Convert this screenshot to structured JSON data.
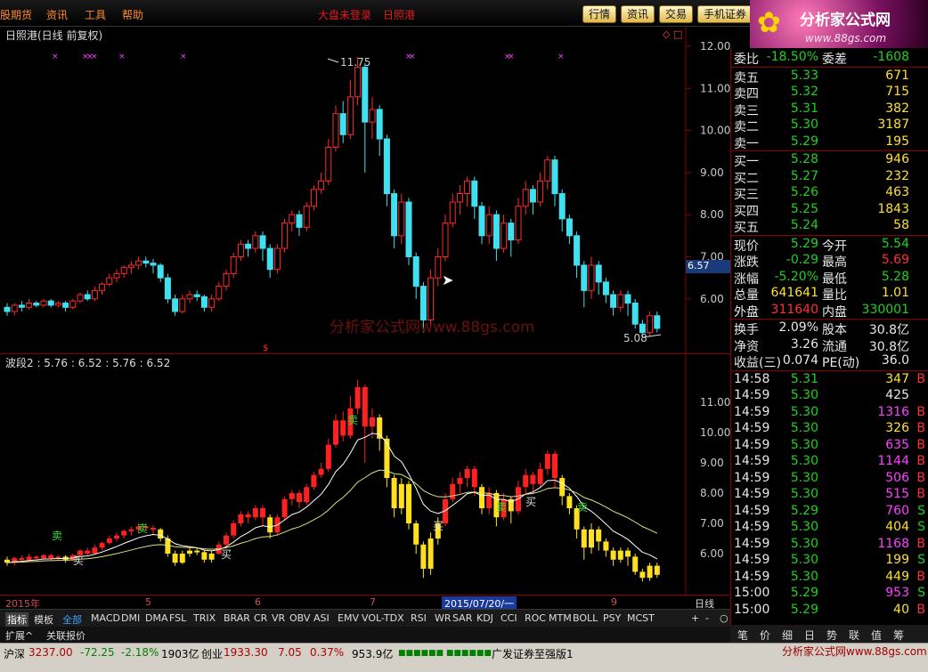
{
  "menu": {
    "items": [
      "股期货",
      "资讯",
      "工具",
      "帮助"
    ],
    "headline": "大盘未登录",
    "headline2": "日照港"
  },
  "quick_buttons": [
    "行情",
    "资讯",
    "交易",
    "手机证券"
  ],
  "logo": {
    "name": "分析家公式网",
    "url": "www.88gs.com"
  },
  "chart": {
    "title": "日照港(日线 前复权)",
    "indicator_title": "波段2 : 5.76 : 6.52      : 5.76 : 6.52",
    "watermark": "分析家公式网www.88gs.com",
    "price_axis": [
      "12.00",
      "11.00",
      "10.00",
      "9.00",
      "8.00",
      "7.00",
      "6.00"
    ],
    "ind_axis": [
      "11.00",
      "10.00",
      "9.00",
      "8.00",
      "7.00",
      "6.00"
    ],
    "high_label": "11.75",
    "low_label": "5.08",
    "current_tag": "6.57",
    "dates": [
      "2015年",
      "5",
      "6",
      "7",
      "2015/07/20/一",
      "9"
    ],
    "period": "日线",
    "candles": [
      [
        5.8,
        5.7,
        5.9,
        5.6
      ],
      [
        5.7,
        5.85,
        5.9,
        5.6
      ],
      [
        5.85,
        5.8,
        5.95,
        5.7
      ],
      [
        5.8,
        5.9,
        6.0,
        5.75
      ],
      [
        5.9,
        5.85,
        5.95,
        5.8
      ],
      [
        5.85,
        5.95,
        6.0,
        5.8
      ],
      [
        5.95,
        5.85,
        6.0,
        5.8
      ],
      [
        5.85,
        5.9,
        5.95,
        5.8
      ],
      [
        5.9,
        5.8,
        5.95,
        5.7
      ],
      [
        5.8,
        5.95,
        6.0,
        5.75
      ],
      [
        5.95,
        6.1,
        6.15,
        5.9
      ],
      [
        6.1,
        6.0,
        6.2,
        5.95
      ],
      [
        6.0,
        6.2,
        6.3,
        5.95
      ],
      [
        6.2,
        6.35,
        6.4,
        6.1
      ],
      [
        6.35,
        6.5,
        6.6,
        6.3
      ],
      [
        6.5,
        6.6,
        6.7,
        6.4
      ],
      [
        6.6,
        6.75,
        6.8,
        6.5
      ],
      [
        6.75,
        6.8,
        6.9,
        6.6
      ],
      [
        6.8,
        6.9,
        7.0,
        6.7
      ],
      [
        6.9,
        6.85,
        7.0,
        6.75
      ],
      [
        6.85,
        6.8,
        6.95,
        6.6
      ],
      [
        6.8,
        6.5,
        6.85,
        6.4
      ],
      [
        6.5,
        6.0,
        6.6,
        5.9
      ],
      [
        6.0,
        5.7,
        6.1,
        5.6
      ],
      [
        5.7,
        6.0,
        6.1,
        5.65
      ],
      [
        6.0,
        6.1,
        6.2,
        5.9
      ],
      [
        6.1,
        6.05,
        6.2,
        5.95
      ],
      [
        6.05,
        5.8,
        6.1,
        5.7
      ],
      [
        5.8,
        6.0,
        6.1,
        5.7
      ],
      [
        6.0,
        6.3,
        6.4,
        5.95
      ],
      [
        6.3,
        6.6,
        6.7,
        6.2
      ],
      [
        6.6,
        7.0,
        7.1,
        6.5
      ],
      [
        7.0,
        7.3,
        7.4,
        6.9
      ],
      [
        7.3,
        7.2,
        7.4,
        7.0
      ],
      [
        7.2,
        7.5,
        7.6,
        7.1
      ],
      [
        7.5,
        7.2,
        7.6,
        6.9
      ],
      [
        7.2,
        6.7,
        7.3,
        6.5
      ],
      [
        6.7,
        7.2,
        7.3,
        6.6
      ],
      [
        7.2,
        7.8,
        7.9,
        7.1
      ],
      [
        7.8,
        8.0,
        8.1,
        7.6
      ],
      [
        8.0,
        7.7,
        8.1,
        7.5
      ],
      [
        7.7,
        8.2,
        8.3,
        7.6
      ],
      [
        8.2,
        8.6,
        8.7,
        8.1
      ],
      [
        8.6,
        8.8,
        9.0,
        8.5
      ],
      [
        8.8,
        9.6,
        9.8,
        8.7
      ],
      [
        9.6,
        10.4,
        10.6,
        9.5
      ],
      [
        10.4,
        9.9,
        10.7,
        9.7
      ],
      [
        9.9,
        10.8,
        11.2,
        9.8
      ],
      [
        10.8,
        11.5,
        11.75,
        10.6
      ],
      [
        11.5,
        10.2,
        11.6,
        9.0
      ],
      [
        10.2,
        10.5,
        10.8,
        9.8
      ],
      [
        10.5,
        9.8,
        10.6,
        9.4
      ],
      [
        9.8,
        8.5,
        9.9,
        8.2
      ],
      [
        8.5,
        7.5,
        8.6,
        7.2
      ],
      [
        7.5,
        8.3,
        8.5,
        7.3
      ],
      [
        8.3,
        7.0,
        8.4,
        6.8
      ],
      [
        7.0,
        6.3,
        7.1,
        6.0
      ],
      [
        6.3,
        5.5,
        6.4,
        5.2
      ],
      [
        5.5,
        6.5,
        6.7,
        5.3
      ],
      [
        6.5,
        7.0,
        7.2,
        6.3
      ],
      [
        7.0,
        7.8,
        8.0,
        6.9
      ],
      [
        7.8,
        8.3,
        8.5,
        7.7
      ],
      [
        8.3,
        8.5,
        8.7,
        8.0
      ],
      [
        8.5,
        8.8,
        8.9,
        8.2
      ],
      [
        8.8,
        8.2,
        8.9,
        7.9
      ],
      [
        8.2,
        7.5,
        8.3,
        7.3
      ],
      [
        7.5,
        8.0,
        8.2,
        7.3
      ],
      [
        8.0,
        7.2,
        8.1,
        6.9
      ],
      [
        7.2,
        7.8,
        8.0,
        7.1
      ],
      [
        7.8,
        7.4,
        7.9,
        7.0
      ],
      [
        7.4,
        8.2,
        8.4,
        7.3
      ],
      [
        8.2,
        8.6,
        8.8,
        8.0
      ],
      [
        8.6,
        8.3,
        8.7,
        8.0
      ],
      [
        8.3,
        8.8,
        9.0,
        8.2
      ],
      [
        8.8,
        9.3,
        9.4,
        8.6
      ],
      [
        9.3,
        8.5,
        9.4,
        8.2
      ],
      [
        8.5,
        7.9,
        8.6,
        7.6
      ],
      [
        7.9,
        7.5,
        8.0,
        7.3
      ],
      [
        7.5,
        6.8,
        7.6,
        6.5
      ],
      [
        6.8,
        6.2,
        6.9,
        5.8
      ],
      [
        6.2,
        6.8,
        7.0,
        6.0
      ],
      [
        6.8,
        6.4,
        6.9,
        6.1
      ],
      [
        6.4,
        6.1,
        6.5,
        5.9
      ],
      [
        6.1,
        5.8,
        6.2,
        5.6
      ],
      [
        5.8,
        6.1,
        6.2,
        5.7
      ],
      [
        6.1,
        5.9,
        6.2,
        5.6
      ],
      [
        5.9,
        5.4,
        6.0,
        5.3
      ],
      [
        5.4,
        5.2,
        5.5,
        5.08
      ],
      [
        5.2,
        5.6,
        5.7,
        5.1
      ],
      [
        5.6,
        5.3,
        5.7,
        5.2
      ]
    ]
  },
  "quote": {
    "weibi": {
      "label": "委比",
      "value": "-18.50%",
      "label2": "委差",
      "value2": "-1608"
    },
    "sells": [
      {
        "label": "卖五",
        "price": "5.33",
        "vol": "671"
      },
      {
        "label": "卖四",
        "price": "5.32",
        "vol": "715"
      },
      {
        "label": "卖三",
        "price": "5.31",
        "vol": "382"
      },
      {
        "label": "卖二",
        "price": "5.30",
        "vol": "3187"
      },
      {
        "label": "卖一",
        "price": "5.29",
        "vol": "195"
      }
    ],
    "buys": [
      {
        "label": "买一",
        "price": "5.28",
        "vol": "946"
      },
      {
        "label": "买二",
        "price": "5.27",
        "vol": "232"
      },
      {
        "label": "买三",
        "price": "5.26",
        "vol": "463"
      },
      {
        "label": "买四",
        "price": "5.25",
        "vol": "1843"
      },
      {
        "label": "买五",
        "price": "5.24",
        "vol": "58"
      }
    ],
    "stats": [
      {
        "l1": "现价",
        "v1": "5.29",
        "l2": "今开",
        "v2": "5.54",
        "c1": "grn",
        "c2": "grn"
      },
      {
        "l1": "涨跌",
        "v1": "-0.29",
        "l2": "最高",
        "v2": "5.69",
        "c1": "grn",
        "c2": "red"
      },
      {
        "l1": "涨幅",
        "v1": "-5.20%",
        "l2": "最低",
        "v2": "5.28",
        "c1": "grn",
        "c2": "grn"
      },
      {
        "l1": "总量",
        "v1": "641641",
        "l2": "量比",
        "v2": "1.01",
        "c1": "yel",
        "c2": "yel"
      },
      {
        "l1": "外盘",
        "v1": "311640",
        "l2": "内盘",
        "v2": "330001",
        "c1": "red",
        "c2": "grn"
      }
    ],
    "stats2": [
      {
        "l1": "换手",
        "v1": "2.09%",
        "l2": "股本",
        "v2": "30.8亿"
      },
      {
        "l1": "净资",
        "v1": "3.26",
        "l2": "流通",
        "v2": "30.8亿"
      },
      {
        "l1": "收益(三)",
        "v1": "0.074",
        "l2": "PE(动)",
        "v2": "36.0"
      }
    ],
    "ticks": [
      {
        "t": "14:58",
        "p": "5.31",
        "v": "347",
        "s": "B",
        "vc": "yel",
        "sc": "red"
      },
      {
        "t": "14:59",
        "p": "5.30",
        "v": "425",
        "s": "",
        "vc": "wht",
        "sc": "red"
      },
      {
        "t": "14:59",
        "p": "5.30",
        "v": "1316",
        "s": "B",
        "vc": "mag",
        "sc": "red"
      },
      {
        "t": "14:59",
        "p": "5.30",
        "v": "326",
        "s": "B",
        "vc": "yel",
        "sc": "red"
      },
      {
        "t": "14:59",
        "p": "5.30",
        "v": "635",
        "s": "B",
        "vc": "mag",
        "sc": "red"
      },
      {
        "t": "14:59",
        "p": "5.30",
        "v": "1144",
        "s": "B",
        "vc": "mag",
        "sc": "red"
      },
      {
        "t": "14:59",
        "p": "5.30",
        "v": "506",
        "s": "B",
        "vc": "mag",
        "sc": "red"
      },
      {
        "t": "14:59",
        "p": "5.30",
        "v": "515",
        "s": "B",
        "vc": "mag",
        "sc": "red"
      },
      {
        "t": "14:59",
        "p": "5.29",
        "v": "760",
        "s": "S",
        "vc": "mag",
        "sc": "grn"
      },
      {
        "t": "14:59",
        "p": "5.30",
        "v": "404",
        "s": "S",
        "vc": "yel",
        "sc": "grn"
      },
      {
        "t": "14:59",
        "p": "5.30",
        "v": "1168",
        "s": "B",
        "vc": "mag",
        "sc": "red"
      },
      {
        "t": "14:59",
        "p": "5.30",
        "v": "199",
        "s": "S",
        "vc": "yel",
        "sc": "grn"
      },
      {
        "t": "14:59",
        "p": "5.30",
        "v": "449",
        "s": "B",
        "vc": "yel",
        "sc": "red"
      },
      {
        "t": "15:00",
        "p": "5.29",
        "v": "953",
        "s": "S",
        "vc": "mag",
        "sc": "grn"
      },
      {
        "t": "15:00",
        "p": "5.29",
        "v": "40",
        "s": "B",
        "vc": "yel",
        "sc": "red"
      }
    ]
  },
  "tabs": [
    "指标",
    "模板",
    "全部",
    "MACD",
    "DMI",
    "DMA",
    "FSL",
    "TRIX",
    "BRAR",
    "CR",
    "VR",
    "OBV",
    "ASI",
    "EMV",
    "VOL-TDX",
    "RSI",
    "WR",
    "SAR",
    "KDJ",
    "CCI",
    "ROC",
    "MTM",
    "BOLL",
    "PSY",
    "MCST"
  ],
  "tabs2": [
    "扩展^",
    "关联报价"
  ],
  "zoom_buttons": [
    "+",
    "-",
    "○"
  ],
  "right_tabs": [
    "笔",
    "价",
    "细",
    "日",
    "势",
    "联",
    "值",
    "筹"
  ],
  "status": {
    "sh_label": "沪深",
    "sh_val": "3237.00",
    "sh_chg": "-72.25",
    "sh_pct": "-2.18%",
    "sh_amt": "1903亿",
    "cy_label": "创业",
    "cy_val": "1933.30",
    "cy_chg": "7.05",
    "cy_pct": "0.37%",
    "cy_amt": "953.9亿",
    "broker": "广发证券至强版1",
    "site": "分析家公式网www.88gs.com"
  },
  "markers": {
    "sell": "卖",
    "buy": "买"
  }
}
